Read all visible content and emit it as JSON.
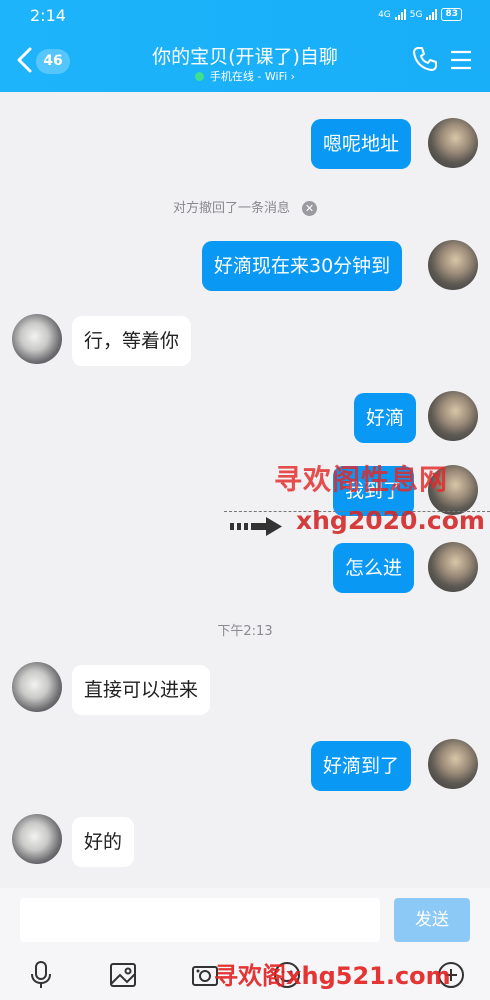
{
  "status_bar": {
    "time": "2:14",
    "signal1": "4G",
    "signal2": "5G",
    "battery": "83"
  },
  "header": {
    "unread_count": "46",
    "title": "你的宝贝(开课了)自聊",
    "subtitle": "手机在线 - WiFi ›"
  },
  "messages": [
    {
      "side": "me",
      "text": "嗯呢地址"
    },
    {
      "type": "notice",
      "text": "对方撤回了一条消息"
    },
    {
      "side": "me",
      "text": "好滴现在来30分钟到"
    },
    {
      "side": "them",
      "text": "行，等着你"
    },
    {
      "side": "me",
      "text": "好滴"
    },
    {
      "side": "me",
      "text": "我到了"
    },
    {
      "side": "me",
      "text": "怎么进"
    },
    {
      "type": "timestamp",
      "text": "下午2:13"
    },
    {
      "side": "them",
      "text": "直接可以进来"
    },
    {
      "side": "me",
      "text": "好滴到了"
    },
    {
      "side": "them",
      "text": "好的"
    }
  ],
  "watermark": {
    "line1": "寻欢阁性息网",
    "line2": "xhg2020.com",
    "bottom": "寻欢阁xhg521.com"
  },
  "input": {
    "placeholder": "",
    "send_label": "发送"
  },
  "toolbar": [
    "microphone-icon",
    "image-icon",
    "camera-icon",
    "emoji-icon",
    "plus-icon"
  ]
}
